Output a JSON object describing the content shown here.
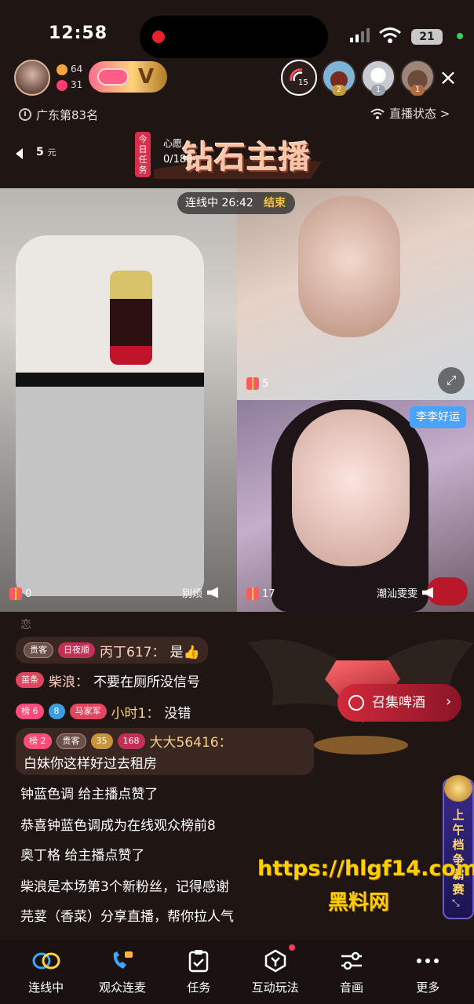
{
  "status_bar": {
    "time": "12:58",
    "battery": "21"
  },
  "host": {
    "fans_count": "64",
    "likes_count": "31",
    "vip_letter": "V"
  },
  "viewers": {
    "radar_count": "15",
    "list": [
      {
        "rank": "2"
      },
      {
        "rank": "1"
      },
      {
        "rank": "1"
      }
    ],
    "close": "×"
  },
  "ranking": {
    "label": "广东第83名",
    "live_status": "直播状态 >"
  },
  "reward": {
    "amount": "5",
    "unit": "元"
  },
  "task": {
    "tag": "今日任务",
    "title": "钻石主播",
    "heart_label": "心愿",
    "progress": "0/188"
  },
  "link_session": {
    "label": "连线中 26:42",
    "end_label": "结束"
  },
  "video": {
    "main": {
      "gift_count": "0",
      "name": "别烦"
    },
    "top_right": {
      "gift_count": "5",
      "expand": "⤢"
    },
    "bottom_right": {
      "gift_count": "17",
      "name": "潮汕雯雯",
      "tag": "李李好运"
    }
  },
  "chat": {
    "faded": "恋",
    "messages": [
      {
        "badges": [
          "贵客",
          "日夜顺"
        ],
        "user": "丙丁617：",
        "text": "是👍"
      },
      {
        "badges": [
          "苗条"
        ],
        "user": "柴浪：",
        "text": "不要在厕所没信号"
      },
      {
        "badges": [
          "榜 6",
          "8",
          "马家军"
        ],
        "user": "小时1：",
        "text": "没错"
      },
      {
        "badges": [
          "榜 2",
          "贵客",
          "35",
          "168"
        ],
        "user": "大大56416：",
        "text": "白妹你这样好过去租房"
      }
    ],
    "system": [
      "钟蓝色调 给主播点赞了",
      "恭喜钟蓝色调成为在线观众榜前8",
      "奥丁格 给主播点赞了",
      "柴浪是本场第3个新粉丝，记得感谢",
      "芫荽（香菜）分享直播，帮你拉人气"
    ]
  },
  "beer": {
    "label": "召集啤酒",
    "chevron": "›"
  },
  "side_promo": {
    "text": "上午档争霸赛",
    "expand": "⤡"
  },
  "watermark": {
    "url": "https://hlgf14.com",
    "name": "黑料网"
  },
  "bottom_bar": [
    {
      "label": "连线中",
      "icon": "link-icon"
    },
    {
      "label": "观众连麦",
      "icon": "phone-icon"
    },
    {
      "label": "任务",
      "icon": "clipboard-icon"
    },
    {
      "label": "互动玩法",
      "icon": "game-icon"
    },
    {
      "label": "音画",
      "icon": "sliders-icon"
    },
    {
      "label": "更多",
      "icon": "more-icon"
    }
  ],
  "colors": {
    "accent_gold": "#f6c343",
    "accent_red": "#d22a3c",
    "watermark": "#ffd000"
  }
}
